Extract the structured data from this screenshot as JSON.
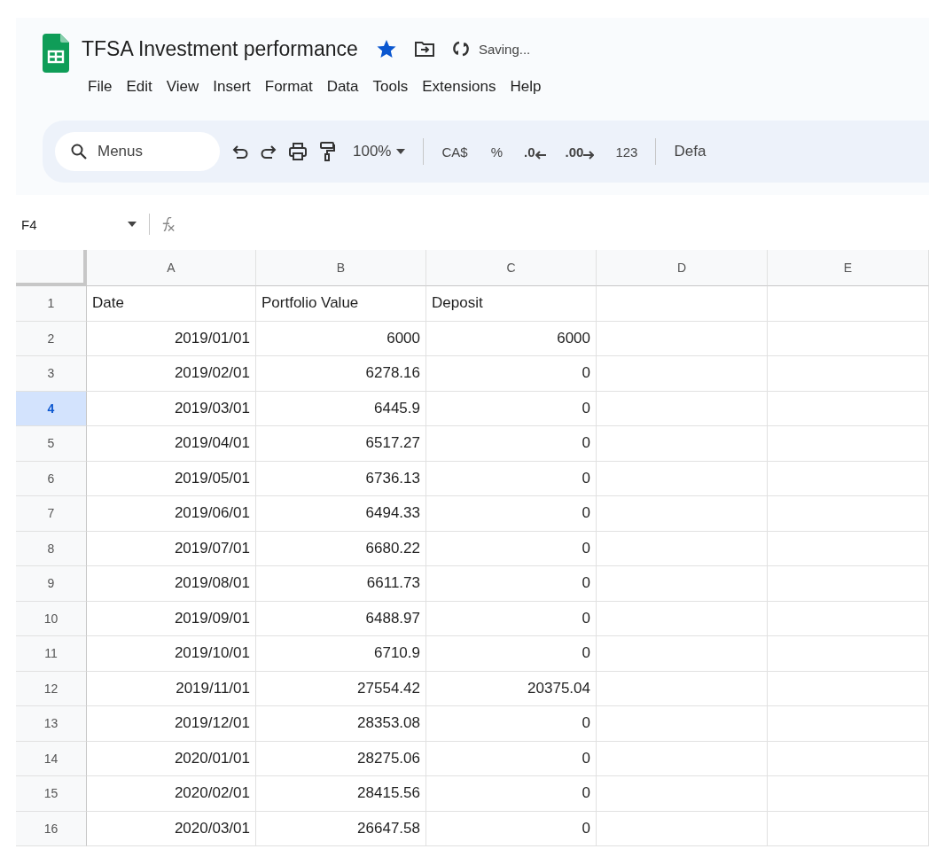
{
  "document": {
    "title": "TFSA Investment performance",
    "starred": true,
    "status": "Saving..."
  },
  "menu": [
    "File",
    "Edit",
    "View",
    "Insert",
    "Format",
    "Data",
    "Tools",
    "Extensions",
    "Help"
  ],
  "toolbar": {
    "search": {
      "placeholder": "Menus"
    },
    "zoom": "100%",
    "currency": "CA$",
    "percent": "%",
    "decrease_decimal": ".0",
    "increase_decimal": ".00",
    "number_format": "123",
    "font": "Defa"
  },
  "formula_bar": {
    "cell_ref": "F4"
  },
  "columns": [
    "A",
    "B",
    "C",
    "D",
    "E"
  ],
  "rows": [
    {
      "number": "1",
      "selected": false,
      "kind": "text",
      "cells": [
        "Date",
        "Portfolio Value",
        "Deposit"
      ]
    },
    {
      "number": "2",
      "selected": false,
      "kind": "number",
      "cells": [
        "2019/01/01",
        "6000",
        "6000"
      ]
    },
    {
      "number": "3",
      "selected": false,
      "kind": "number",
      "cells": [
        "2019/02/01",
        "6278.16",
        "0"
      ]
    },
    {
      "number": "4",
      "selected": true,
      "kind": "number",
      "cells": [
        "2019/03/01",
        "6445.9",
        "0"
      ]
    },
    {
      "number": "5",
      "selected": false,
      "kind": "number",
      "cells": [
        "2019/04/01",
        "6517.27",
        "0"
      ]
    },
    {
      "number": "6",
      "selected": false,
      "kind": "number",
      "cells": [
        "2019/05/01",
        "6736.13",
        "0"
      ]
    },
    {
      "number": "7",
      "selected": false,
      "kind": "number",
      "cells": [
        "2019/06/01",
        "6494.33",
        "0"
      ]
    },
    {
      "number": "8",
      "selected": false,
      "kind": "number",
      "cells": [
        "2019/07/01",
        "6680.22",
        "0"
      ]
    },
    {
      "number": "9",
      "selected": false,
      "kind": "number",
      "cells": [
        "2019/08/01",
        "6611.73",
        "0"
      ]
    },
    {
      "number": "10",
      "selected": false,
      "kind": "number",
      "cells": [
        "2019/09/01",
        "6488.97",
        "0"
      ]
    },
    {
      "number": "11",
      "selected": false,
      "kind": "number",
      "cells": [
        "2019/10/01",
        "6710.9",
        "0"
      ]
    },
    {
      "number": "12",
      "selected": false,
      "kind": "number",
      "cells": [
        "2019/11/01",
        "27554.42",
        "20375.04"
      ]
    },
    {
      "number": "13",
      "selected": false,
      "kind": "number",
      "cells": [
        "2019/12/01",
        "28353.08",
        "0"
      ]
    },
    {
      "number": "14",
      "selected": false,
      "kind": "number",
      "cells": [
        "2020/01/01",
        "28275.06",
        "0"
      ]
    },
    {
      "number": "15",
      "selected": false,
      "kind": "number",
      "cells": [
        "2020/02/01",
        "28415.56",
        "0"
      ]
    },
    {
      "number": "16",
      "selected": false,
      "kind": "number",
      "cells": [
        "2020/03/01",
        "26647.58",
        "0"
      ]
    }
  ]
}
